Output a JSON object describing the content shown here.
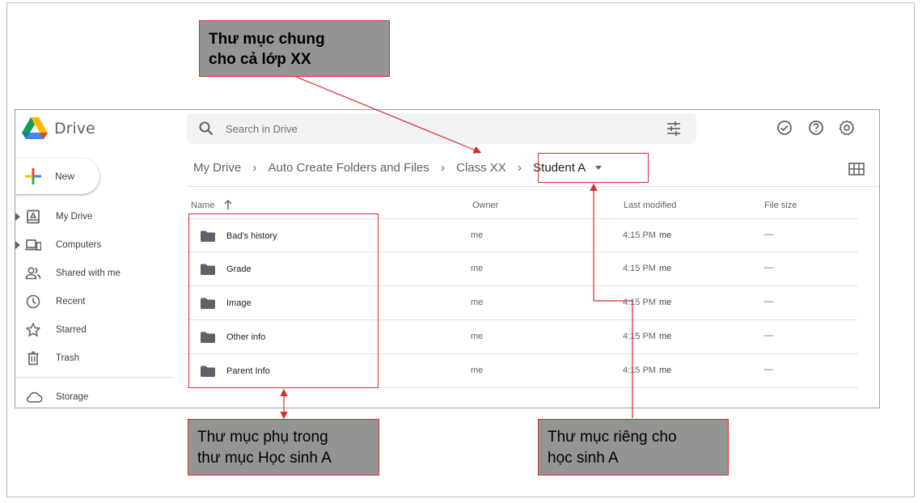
{
  "app": {
    "name": "Drive"
  },
  "search": {
    "placeholder": "Search in Drive"
  },
  "new_button": {
    "label": "New"
  },
  "nav": [
    {
      "label": "My Drive",
      "icon": "my-drive-icon",
      "expandable": true
    },
    {
      "label": "Computers",
      "icon": "computers-icon",
      "expandable": true
    },
    {
      "label": "Shared with me",
      "icon": "shared-icon",
      "expandable": false
    },
    {
      "label": "Recent",
      "icon": "clock-icon",
      "expandable": false
    },
    {
      "label": "Starred",
      "icon": "star-icon",
      "expandable": false
    },
    {
      "label": "Trash",
      "icon": "trash-icon",
      "expandable": false
    }
  ],
  "storage": {
    "label": "Storage",
    "icon": "cloud-icon"
  },
  "breadcrumb": [
    "My Drive",
    "Auto Create Folders and Files",
    "Class XX",
    "Student A"
  ],
  "columns": {
    "name": "Name",
    "owner": "Owner",
    "modified": "Last modified",
    "size": "File size"
  },
  "files": [
    {
      "name": "Bad's history",
      "owner": "me",
      "modified": "4:15 PM",
      "modified_by": "me",
      "size": "—"
    },
    {
      "name": "Grade",
      "owner": "me",
      "modified": "4:15 PM",
      "modified_by": "me",
      "size": "—"
    },
    {
      "name": "Image",
      "owner": "me",
      "modified": "4:15 PM",
      "modified_by": "me",
      "size": "—"
    },
    {
      "name": "Other info",
      "owner": "me",
      "modified": "4:15 PM",
      "modified_by": "me",
      "size": "—"
    },
    {
      "name": "Parent Info",
      "owner": "me",
      "modified": "4:15 PM",
      "modified_by": "me",
      "size": "—"
    }
  ],
  "callouts": {
    "shared_folder": [
      "Thư mục chung",
      "cho cả lớp XX"
    ],
    "subfolders": [
      "Thư mục phụ trong",
      "thư mục Học sinh A"
    ],
    "private_folder": [
      "Thư mục riêng cho",
      "học sinh A"
    ]
  },
  "colors": {
    "annotation": "#d32f2f",
    "callout_bg": "#949494",
    "folder": "#5f6368"
  }
}
